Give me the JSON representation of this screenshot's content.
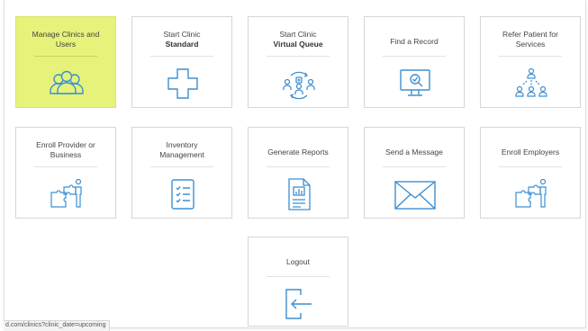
{
  "tiles": {
    "manage": {
      "line1": "Manage Clinics and",
      "line2": "Users",
      "icon": "users-group-icon"
    },
    "start_standard": {
      "line1": "Start Clinic",
      "line2": "Standard",
      "icon": "medical-cross-icon"
    },
    "start_virtual": {
      "line1": "Start Clinic",
      "line2": "Virtual Queue",
      "icon": "virtual-queue-icon"
    },
    "find_record": {
      "line1": "Find a Record",
      "icon": "monitor-search-icon"
    },
    "refer": {
      "line1": "Refer Patient for",
      "line2": "Services",
      "icon": "referral-network-icon"
    },
    "enroll_provider": {
      "line1": "Enroll Provider or",
      "line2": "Business",
      "icon": "puzzle-person-icon"
    },
    "inventory": {
      "line1": "Inventory",
      "line2": "Management",
      "icon": "clipboard-checklist-icon"
    },
    "reports": {
      "line1": "Generate Reports",
      "icon": "report-chart-icon"
    },
    "message": {
      "line1": "Send a Message",
      "icon": "envelope-icon"
    },
    "enroll_employers": {
      "line1": "Enroll Employers",
      "icon": "puzzle-person-icon"
    },
    "logout": {
      "line1": "Logout",
      "icon": "logout-arrow-icon"
    }
  },
  "status_bar": {
    "url": "d.com/clinics?clinic_date=upcoming"
  },
  "colors": {
    "active_tile": "#e6f27a",
    "icon_stroke": "#3d8fd1",
    "border": "#d6d6d6"
  }
}
